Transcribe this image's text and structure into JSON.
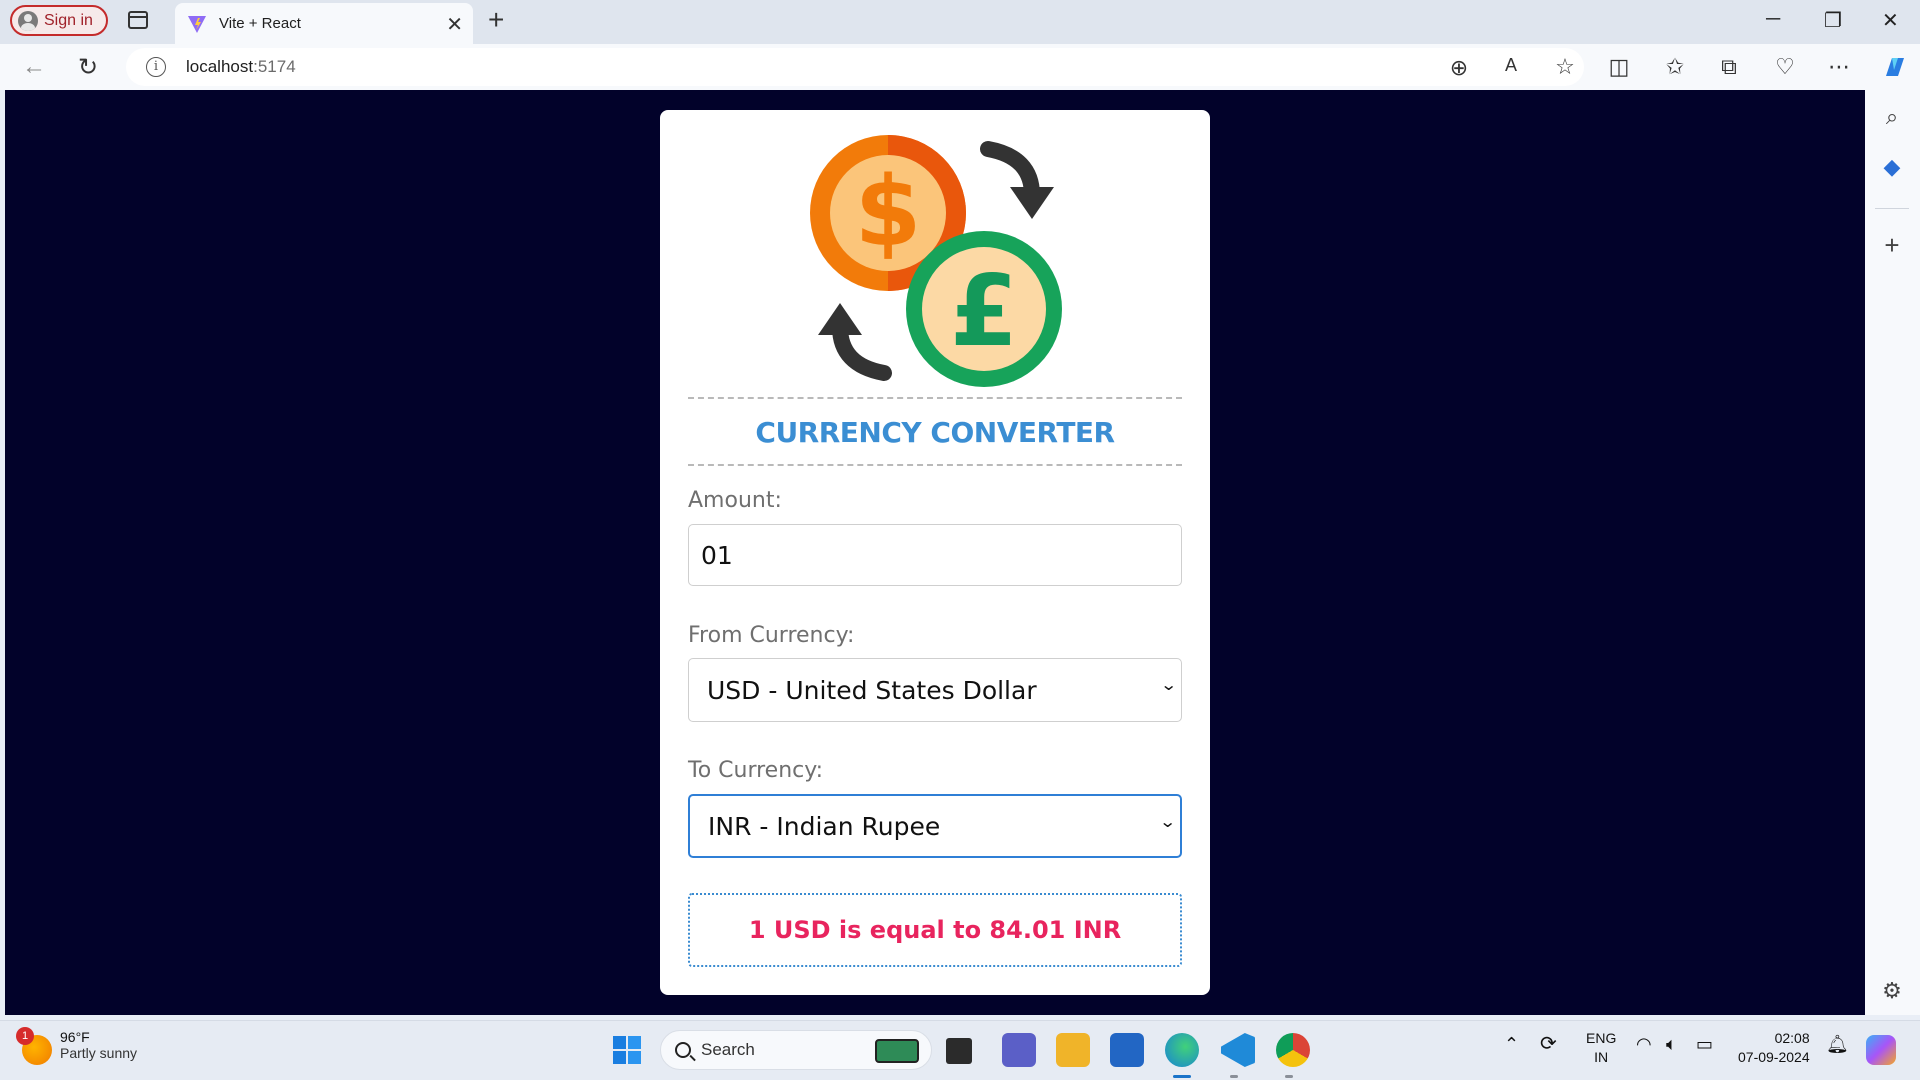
{
  "browser": {
    "signin_label": "Sign in",
    "tab_title": "Vite + React",
    "url_host": "localhost",
    "url_port": ":5174"
  },
  "app": {
    "title": "CURRENCY CONVERTER",
    "amount_label": "Amount:",
    "amount_value": "01",
    "from_label": "From Currency:",
    "from_value": "USD - United States Dollar",
    "to_label": "To Currency:",
    "to_value": "INR - Indian Rupee",
    "result": "1 USD is equal to 84.01 INR",
    "colors": {
      "page_bg": "#02022a",
      "title": "#3b8ed3",
      "result": "#e8245e"
    }
  },
  "taskbar": {
    "weather_badge": "1",
    "temperature": "96°F",
    "condition": "Partly sunny",
    "search_placeholder": "Search",
    "lang_line1": "ENG",
    "lang_line2": "IN",
    "time": "02:08",
    "date": "07-09-2024"
  }
}
